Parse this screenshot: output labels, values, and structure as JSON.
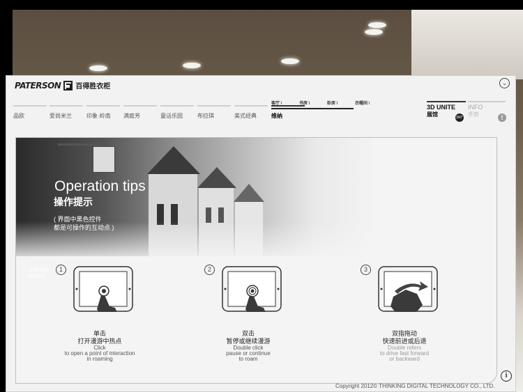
{
  "colors": {
    "panel_bg": "#f2f2f2",
    "dark_text": "#222222",
    "accent_dark": "#333333",
    "muted": "#aaaaaa"
  },
  "header": {
    "logo_brand": "PATERSON",
    "logo_cn": "百得胜衣柜",
    "collapse_icon": "chevron-down-icon"
  },
  "nav": {
    "items": [
      "品欧",
      "爱尚米兰",
      "印象·岭南",
      "满庭芳",
      "童话乐园",
      "布拉琪",
      "美式经典",
      "维纳"
    ],
    "active_index": 7
  },
  "rooms": {
    "items": [
      "客厅 \\",
      "书房 \\",
      "卧房 \\",
      "衣帽间 \\"
    ]
  },
  "tabs": {
    "unite_title": "3D UNITE",
    "unite_sub": "展馆",
    "badge": "360°",
    "info_title": "INFO",
    "info_sub": "手势",
    "warn_icon": "!"
  },
  "tips": {
    "title": "Operation tips",
    "title_cn": "操作提示",
    "note_line1": "( 界面中黑色控件",
    "note_line2": "都是可操作的互动点 )",
    "watermark_cn": "品牌传奇",
    "watermark_en": "BRAND"
  },
  "steps": [
    {
      "num": "1",
      "cn_title": "单击",
      "cn_desc": "打开漫游中热点",
      "en_title": "Click",
      "en_desc1": "to open a point of interaction",
      "en_desc2": "in roaming"
    },
    {
      "num": "2",
      "cn_title": "双击",
      "cn_desc": "暂停或继续漫游",
      "en_title": "Double click",
      "en_desc1": "pause or continue",
      "en_desc2": "to roam"
    },
    {
      "num": "3",
      "cn_title": "双指拖动",
      "cn_desc": "快速前进或后退",
      "en_title": "Double refers",
      "en_desc1": "to drive fast forward",
      "en_desc2": "or backward"
    }
  ],
  "footer": {
    "info_icon": "i",
    "copyright": "Copyright 2012© THINKING DIGITAL TECHNOLOGY CO., LTD."
  }
}
